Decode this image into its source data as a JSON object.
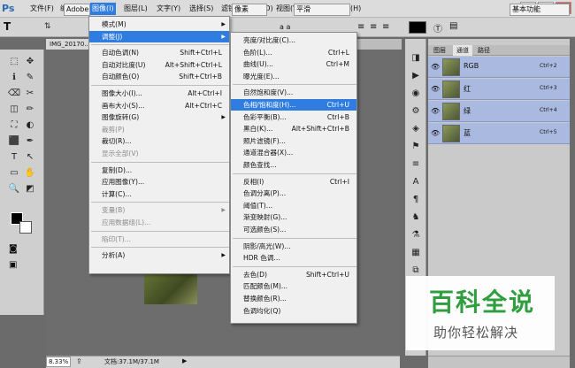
{
  "app": {
    "logo": "Ps"
  },
  "menubar": {
    "items": [
      "文件(F)",
      "编辑(E)",
      "图像(I)",
      "图层(L)",
      "文字(Y)",
      "选择(S)",
      "滤镜(T)",
      "3D(D)",
      "视图(V)",
      "窗口(W)",
      "帮助(H)"
    ]
  },
  "window_controls": {
    "minimize": "—",
    "restore": "▭",
    "close": "✕"
  },
  "options_bar": {
    "font_family": "Adobe ...",
    "unit": "像素",
    "aa": "a a",
    "aa_mode": "平滑",
    "workspace": "基本功能"
  },
  "document": {
    "tab_title": "IMG_20170..."
  },
  "status": {
    "zoom": "8.33%",
    "doc": "文档:37.1M/37.1M"
  },
  "image_menu": {
    "items": [
      {
        "label": "模式(M)",
        "shortcut": "",
        "sub": true
      },
      {
        "label": "调整(J)",
        "shortcut": "",
        "sub": true,
        "hl": true
      },
      {
        "label": "自动色调(N)",
        "shortcut": "Shift+Ctrl+L"
      },
      {
        "label": "自动对比度(U)",
        "shortcut": "Alt+Shift+Ctrl+L"
      },
      {
        "label": "自动颜色(O)",
        "shortcut": "Shift+Ctrl+B"
      },
      {
        "label": "图像大小(I)...",
        "shortcut": "Alt+Ctrl+I"
      },
      {
        "label": "画布大小(S)...",
        "shortcut": "Alt+Ctrl+C"
      },
      {
        "label": "图像旋转(G)",
        "shortcut": "",
        "sub": true
      },
      {
        "label": "裁剪(P)",
        "shortcut": "",
        "dis": true
      },
      {
        "label": "裁切(R)...",
        "shortcut": ""
      },
      {
        "label": "显示全部(V)",
        "shortcut": "",
        "dis": true
      },
      {
        "label": "复制(D)...",
        "shortcut": ""
      },
      {
        "label": "应用图像(Y)...",
        "shortcut": ""
      },
      {
        "label": "计算(C)...",
        "shortcut": ""
      },
      {
        "label": "变量(B)",
        "shortcut": "",
        "sub": true,
        "dis": true
      },
      {
        "label": "应用数据组(L)...",
        "shortcut": "",
        "dis": true
      },
      {
        "label": "陷印(T)...",
        "shortcut": "",
        "dis": true
      },
      {
        "label": "分析(A)",
        "shortcut": "",
        "sub": true
      }
    ]
  },
  "adjust_menu": {
    "items": [
      {
        "label": "亮度/对比度(C)...",
        "shortcut": ""
      },
      {
        "label": "色阶(L)...",
        "shortcut": "Ctrl+L"
      },
      {
        "label": "曲线(U)...",
        "shortcut": "Ctrl+M"
      },
      {
        "label": "曝光度(E)...",
        "shortcut": ""
      },
      {
        "label": "自然饱和度(V)...",
        "shortcut": ""
      },
      {
        "label": "色相/饱和度(H)...",
        "shortcut": "Ctrl+U",
        "hl": true
      },
      {
        "label": "色彩平衡(B)...",
        "shortcut": "Ctrl+B"
      },
      {
        "label": "黑白(K)...",
        "shortcut": "Alt+Shift+Ctrl+B"
      },
      {
        "label": "照片滤镜(F)...",
        "shortcut": ""
      },
      {
        "label": "通道混合器(X)...",
        "shortcut": ""
      },
      {
        "label": "颜色查找...",
        "shortcut": ""
      },
      {
        "label": "反相(I)",
        "shortcut": "Ctrl+I"
      },
      {
        "label": "色调分离(P)...",
        "shortcut": ""
      },
      {
        "label": "阈值(T)...",
        "shortcut": ""
      },
      {
        "label": "渐变映射(G)...",
        "shortcut": ""
      },
      {
        "label": "可选颜色(S)...",
        "shortcut": ""
      },
      {
        "label": "阴影/高光(W)...",
        "shortcut": ""
      },
      {
        "label": "HDR 色调...",
        "shortcut": ""
      },
      {
        "label": "去色(D)",
        "shortcut": "Shift+Ctrl+U"
      },
      {
        "label": "匹配颜色(M)...",
        "shortcut": ""
      },
      {
        "label": "替换颜色(R)...",
        "shortcut": ""
      },
      {
        "label": "色调均化(Q)",
        "shortcut": ""
      }
    ]
  },
  "channels_panel": {
    "tabs": [
      "图层",
      "通道",
      "路径"
    ],
    "rows": [
      {
        "name": "RGB",
        "key": "Ctrl+2"
      },
      {
        "name": "红",
        "key": "Ctrl+3"
      },
      {
        "name": "绿",
        "key": "Ctrl+4"
      },
      {
        "name": "蓝",
        "key": "Ctrl+5"
      }
    ]
  },
  "tools": [
    "⬚",
    "✥",
    "ℹ",
    "✎",
    "⌫",
    "✂",
    "◫",
    "✏",
    "⛶",
    "◐",
    "⬛",
    "✒",
    "T",
    "↖",
    "▭",
    "✋",
    "🔍",
    "◩"
  ],
  "right_icons": [
    "◨",
    "▶",
    "◉",
    "⚙",
    "◈",
    "⚑",
    "≡",
    "A",
    "¶",
    "♞",
    "⚗",
    "▦",
    "⧉"
  ],
  "watermark": {
    "title": "百科全说",
    "subtitle": "助你轻松解决"
  }
}
